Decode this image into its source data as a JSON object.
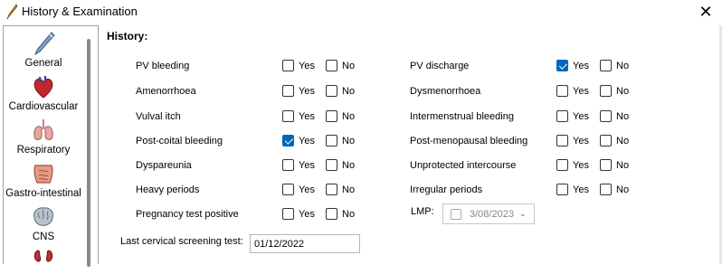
{
  "window": {
    "title": "History & Examination"
  },
  "sidebar": {
    "items": [
      {
        "label": "General",
        "icon": "pen-icon"
      },
      {
        "label": "Cardiovascular",
        "icon": "heart-icon"
      },
      {
        "label": "Respiratory",
        "icon": "lungs-icon"
      },
      {
        "label": "Gastro-intestinal",
        "icon": "intestine-icon"
      },
      {
        "label": "CNS",
        "icon": "brain-icon"
      },
      {
        "label": "",
        "icon": "kidney-icon"
      }
    ]
  },
  "history": {
    "title": "History:",
    "yes_label": "Yes",
    "no_label": "No",
    "left": [
      {
        "label": "PV bleeding",
        "yes": false,
        "no": false
      },
      {
        "label": "Amenorrhoea",
        "yes": false,
        "no": false
      },
      {
        "label": "Vulval itch",
        "yes": false,
        "no": false
      },
      {
        "label": "Post-coital bleeding",
        "yes": true,
        "no": false
      },
      {
        "label": "Dyspareunia",
        "yes": false,
        "no": false
      },
      {
        "label": "Heavy periods",
        "yes": false,
        "no": false
      },
      {
        "label": "Pregnancy test positive",
        "yes": false,
        "no": false
      }
    ],
    "right": [
      {
        "label": "PV discharge",
        "yes": true,
        "no": false
      },
      {
        "label": "Dysmenorrhoea",
        "yes": false,
        "no": false
      },
      {
        "label": "Intermenstrual bleeding",
        "yes": false,
        "no": false
      },
      {
        "label": "Post-menopausal bleeding",
        "yes": false,
        "no": false
      },
      {
        "label": "Unprotected intercourse",
        "yes": false,
        "no": false
      },
      {
        "label": "Irregular periods",
        "yes": false,
        "no": false
      }
    ],
    "lmp": {
      "label": "LMP:",
      "value": "3/08/2023",
      "checked": false
    },
    "cervical_screening": {
      "label": "Last cervical screening test:",
      "value": "01/12/2022"
    }
  },
  "colors": {
    "accent": "#0067c0"
  }
}
